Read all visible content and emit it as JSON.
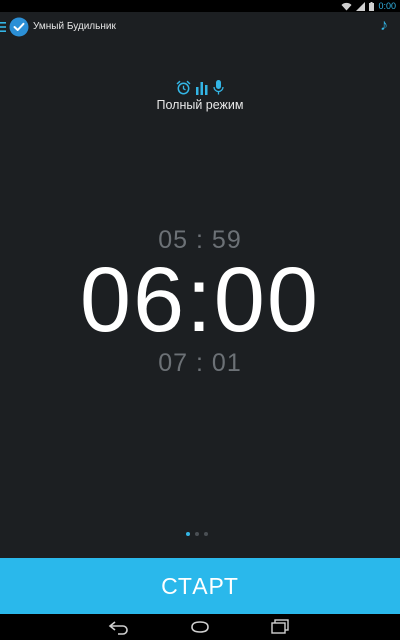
{
  "status_bar": {
    "time": "0:00",
    "icons": [
      "wifi-icon",
      "signal-icon",
      "battery-icon"
    ]
  },
  "app_bar": {
    "title": "Умный Будильник",
    "menu_icon": "hamburger-icon",
    "logo_icon": "alarm-check-logo",
    "music_icon": "music-note-icon"
  },
  "mode": {
    "label": "Полный режим",
    "icons": [
      "alarm-clock-icon",
      "bar-chart-icon",
      "microphone-icon"
    ]
  },
  "time_picker": {
    "previous": "05 : 59",
    "current": "06:00",
    "next": "07 : 01"
  },
  "pager": {
    "count": 3,
    "active_index": 0
  },
  "start_button": {
    "label": "СТАРТ"
  },
  "nav_bar": {
    "icons": [
      "back-icon",
      "home-icon",
      "recent-apps-icon"
    ]
  },
  "colors": {
    "accent": "#33b5e5",
    "start_button": "#2ab8eb",
    "background": "#1c1f22"
  }
}
